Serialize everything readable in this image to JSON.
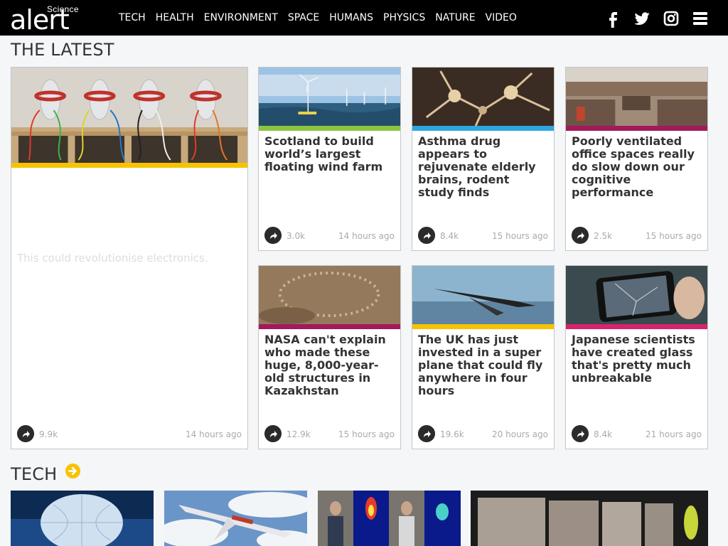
{
  "brand": {
    "small": "Science",
    "big": "alert"
  },
  "nav": [
    "TECH",
    "HEALTH",
    "ENVIRONMENT",
    "SPACE",
    "HUMANS",
    "PHYSICS",
    "NATURE",
    "VIDEO"
  ],
  "social": [
    "facebook-icon",
    "twitter-icon",
    "instagram-icon",
    "menu-icon"
  ],
  "latest": {
    "title": "THE LATEST",
    "featured": {
      "title": "",
      "subtitle": "This could revolutionise electronics.",
      "shares": "9.9k",
      "time": "14 hours ago",
      "stripe": "#f7c200"
    },
    "cards": [
      {
        "title": "Scotland to build world’s largest floating wind farm",
        "shares": "3.0k",
        "time": "14 hours ago",
        "stripe": "#8cc63f"
      },
      {
        "title": "Asthma drug appears to rejuvenate elderly brains, rodent study finds",
        "shares": "8.4k",
        "time": "15 hours ago",
        "stripe": "#2ea7e0"
      },
      {
        "title": "Poorly ventilated office spaces really do slow down our cognitive performance",
        "shares": "2.5k",
        "time": "15 hours ago",
        "stripe": "#a3195b"
      },
      {
        "title": "NASA can't explain who made these huge, 8,000-year-old structures in Kazakhstan",
        "shares": "12.9k",
        "time": "15 hours ago",
        "stripe": "#a3195b"
      },
      {
        "title": "The UK has just invested in a super plane that could fly anywhere in four hours",
        "shares": "19.6k",
        "time": "20 hours ago",
        "stripe": "#f7c200"
      },
      {
        "title": "Japanese scientists have created glass that's pretty much unbreakable",
        "shares": "8.4k",
        "time": "21 hours ago",
        "stripe": "#d6236e"
      }
    ]
  },
  "tech": {
    "title": "TECH"
  }
}
